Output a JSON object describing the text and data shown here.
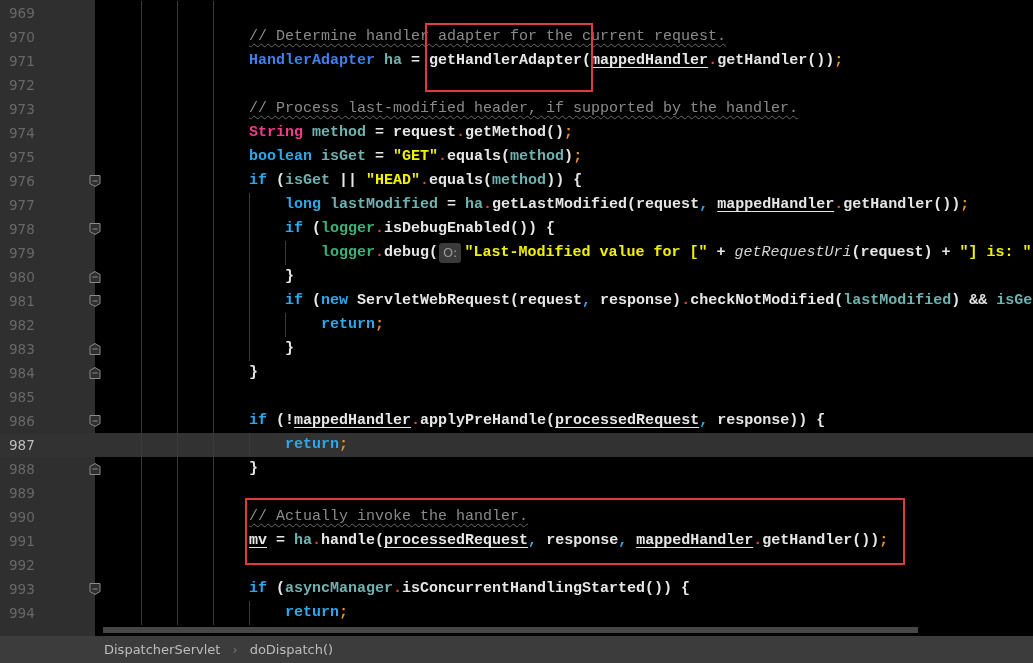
{
  "editor": {
    "lines": [
      {
        "kind": "line",
        "number": "969",
        "current": false
      },
      {
        "kind": "line",
        "number": "970",
        "current": false,
        "tokens": [
          {
            "kind": "comment",
            "text": "// Determine handler adapter for the current request."
          }
        ]
      },
      {
        "kind": "line",
        "number": "971",
        "current": false,
        "tokens": [
          {
            "kind": "type",
            "text": "HandlerAdapter "
          },
          {
            "kind": "var",
            "text": "ha"
          },
          {
            "kind": "plain",
            "text": " = "
          },
          {
            "kind": "boxed",
            "text": "getHandlerAdapter("
          },
          {
            "kind": "underline",
            "text": "mappedHandler"
          },
          {
            "kind": "dot",
            "text": "."
          },
          {
            "kind": "plain",
            "text": "getHandler())"
          },
          {
            "kind": "semi",
            "text": ";"
          }
        ]
      },
      {
        "kind": "line",
        "number": "972",
        "current": false
      },
      {
        "kind": "line",
        "number": "973",
        "current": false,
        "tokens": [
          {
            "kind": "comment",
            "text": "// Process last-modified header, if supported by the handler."
          }
        ]
      },
      {
        "kind": "line",
        "number": "974",
        "current": false,
        "tokens": [
          {
            "kind": "class",
            "text": "String "
          },
          {
            "kind": "var",
            "text": "method"
          },
          {
            "kind": "plain",
            "text": " = request"
          },
          {
            "kind": "dot",
            "text": "."
          },
          {
            "kind": "plain",
            "text": "getMethod()"
          },
          {
            "kind": "semi",
            "text": ";"
          }
        ]
      },
      {
        "kind": "line",
        "number": "975",
        "current": false,
        "tokens": [
          {
            "kind": "keyword",
            "text": "boolean "
          },
          {
            "kind": "var",
            "text": "isGet"
          },
          {
            "kind": "plain",
            "text": " = "
          },
          {
            "kind": "string",
            "text": "\"GET\""
          },
          {
            "kind": "dot",
            "text": "."
          },
          {
            "kind": "plain",
            "text": "equals("
          },
          {
            "kind": "var",
            "text": "method"
          },
          {
            "kind": "plain",
            "text": ")"
          },
          {
            "kind": "semi",
            "text": ";"
          }
        ]
      },
      {
        "kind": "line",
        "number": "976",
        "current": false,
        "tokens": [
          {
            "kind": "keyword",
            "text": "if"
          },
          {
            "kind": "plain",
            "text": " ("
          },
          {
            "kind": "var",
            "text": "isGet"
          },
          {
            "kind": "plain",
            "text": " || "
          },
          {
            "kind": "string",
            "text": "\"HEAD\""
          },
          {
            "kind": "dot",
            "text": "."
          },
          {
            "kind": "plain",
            "text": "equals("
          },
          {
            "kind": "var",
            "text": "method"
          },
          {
            "kind": "plain",
            "text": ")) {"
          }
        ],
        "children": [
          {
            "number": "977",
            "current": false,
            "tokens": [
              {
                "kind": "keyword",
                "text": "long "
              },
              {
                "kind": "var",
                "text": "lastModified"
              },
              {
                "kind": "plain",
                "text": " = "
              },
              {
                "kind": "var",
                "text": "ha"
              },
              {
                "kind": "dot",
                "text": "."
              },
              {
                "kind": "plain",
                "text": "getLastModified(request"
              },
              {
                "kind": "comma",
                "text": ", "
              },
              {
                "kind": "underline",
                "text": "mappedHandler"
              },
              {
                "kind": "dot",
                "text": "."
              },
              {
                "kind": "plain",
                "text": "getHandler())"
              },
              {
                "kind": "semi",
                "text": ";"
              }
            ]
          },
          {
            "number": "978",
            "current": false,
            "tokens": [
              {
                "kind": "keyword",
                "text": "if"
              },
              {
                "kind": "plain",
                "text": " ("
              },
              {
                "kind": "field",
                "text": "logger"
              },
              {
                "kind": "dot",
                "text": "."
              },
              {
                "kind": "plain",
                "text": "isDebugEnabled()) {"
              }
            ],
            "children": [
              {
                "number": "979",
                "current": false,
                "tokens": [
                  {
                    "kind": "field",
                    "text": "logger"
                  },
                  {
                    "kind": "dot",
                    "text": "."
                  },
                  {
                    "kind": "plain",
                    "text": "debug("
                  },
                  {
                    "kind": "hint",
                    "text": "O:"
                  },
                  {
                    "kind": "string",
                    "text": "\"Last-Modified value for [\""
                  },
                  {
                    "kind": "plain",
                    "text": " + "
                  },
                  {
                    "kind": "italic",
                    "text": "getRequestUri"
                  },
                  {
                    "kind": "plain",
                    "text": "(request) + "
                  },
                  {
                    "kind": "string",
                    "text": "\"] is: \""
                  }
                ]
              }
            ],
            "closing": {
              "number": "980",
              "current": false,
              "tokens": [
                {
                  "kind": "plain",
                  "text": "}"
                }
              ]
            }
          },
          {
            "number": "981",
            "current": false,
            "tokens": [
              {
                "kind": "keyword",
                "text": "if"
              },
              {
                "kind": "plain",
                "text": " ("
              },
              {
                "kind": "keyword",
                "text": "new"
              },
              {
                "kind": "plain",
                "text": " ServletWebRequest(request"
              },
              {
                "kind": "comma",
                "text": ","
              },
              {
                "kind": "plain",
                "text": " response)"
              },
              {
                "kind": "dot",
                "text": "."
              },
              {
                "kind": "plain",
                "text": "checkNotModified("
              },
              {
                "kind": "var",
                "text": "lastModified"
              },
              {
                "kind": "plain",
                "text": ") && "
              },
              {
                "kind": "var",
                "text": "isGe"
              }
            ],
            "children": [
              {
                "number": "982",
                "current": false,
                "tokens": [
                  {
                    "kind": "keyword",
                    "text": "return"
                  },
                  {
                    "kind": "semi",
                    "text": ";"
                  }
                ]
              }
            ],
            "closing": {
              "number": "983",
              "current": false,
              "tokens": [
                {
                  "kind": "plain",
                  "text": "}"
                }
              ]
            }
          }
        ],
        "closing": {
          "number": "984",
          "current": false,
          "tokens": [
            {
              "kind": "plain",
              "text": "}"
            }
          ]
        }
      },
      {
        "kind": "line",
        "number": "985",
        "current": false
      },
      {
        "kind": "line",
        "number": "986",
        "current": false,
        "tokens": [
          {
            "kind": "keyword",
            "text": "if"
          },
          {
            "kind": "plain",
            "text": " (!"
          },
          {
            "kind": "underline",
            "text": "mappedHandler"
          },
          {
            "kind": "dot",
            "text": "."
          },
          {
            "kind": "plain",
            "text": "applyPreHandle("
          },
          {
            "kind": "underline",
            "text": "processedRequest"
          },
          {
            "kind": "comma",
            "text": ","
          },
          {
            "kind": "plain",
            "text": " response)) {"
          }
        ],
        "children": [
          {
            "number": "987",
            "current": true,
            "tokens": [
              {
                "kind": "keyword",
                "text": "return"
              },
              {
                "kind": "semi",
                "text": ";"
              }
            ]
          }
        ],
        "closing": {
          "number": "988",
          "current": false,
          "tokens": [
            {
              "kind": "plain",
              "text": "}"
            }
          ]
        }
      },
      {
        "kind": "line",
        "number": "989",
        "current": false
      },
      {
        "kind": "box",
        "children": [
          {
            "number": "990",
            "current": false,
            "tokens": [
              {
                "kind": "comment",
                "text": "// Actually invoke the handler."
              }
            ]
          },
          {
            "number": "991",
            "current": false,
            "tokens": [
              {
                "kind": "underline",
                "text": "mv"
              },
              {
                "kind": "plain",
                "text": " = "
              },
              {
                "kind": "var",
                "text": "ha"
              },
              {
                "kind": "dot",
                "text": "."
              },
              {
                "kind": "plain",
                "text": "handle("
              },
              {
                "kind": "underline",
                "text": "processedRequest"
              },
              {
                "kind": "comma",
                "text": ","
              },
              {
                "kind": "plain",
                "text": " response"
              },
              {
                "kind": "comma",
                "text": ", "
              },
              {
                "kind": "underline",
                "text": "mappedHandler"
              },
              {
                "kind": "dot",
                "text": "."
              },
              {
                "kind": "plain",
                "text": "getHandler())"
              },
              {
                "kind": "semi",
                "text": ";"
              }
            ]
          },
          {
            "number": "992",
            "current": false
          }
        ]
      },
      {
        "kind": "line",
        "number": "993",
        "current": false,
        "tokens": [
          {
            "kind": "keyword",
            "text": "if"
          },
          {
            "kind": "plain",
            "text": " ("
          },
          {
            "kind": "var",
            "text": "asyncManager"
          },
          {
            "kind": "dot",
            "text": "."
          },
          {
            "kind": "plain",
            "text": "isConcurrentHandlingStarted()) {"
          }
        ],
        "children": [
          {
            "number": "994",
            "current": false,
            "tokens": [
              {
                "kind": "keyword",
                "text": "return"
              },
              {
                "kind": "semi",
                "text": ";"
              }
            ]
          }
        ]
      }
    ]
  },
  "breadcrumbs": {
    "separator": "›",
    "items": [
      "DispatcherServlet",
      "doDispatch()"
    ]
  }
}
